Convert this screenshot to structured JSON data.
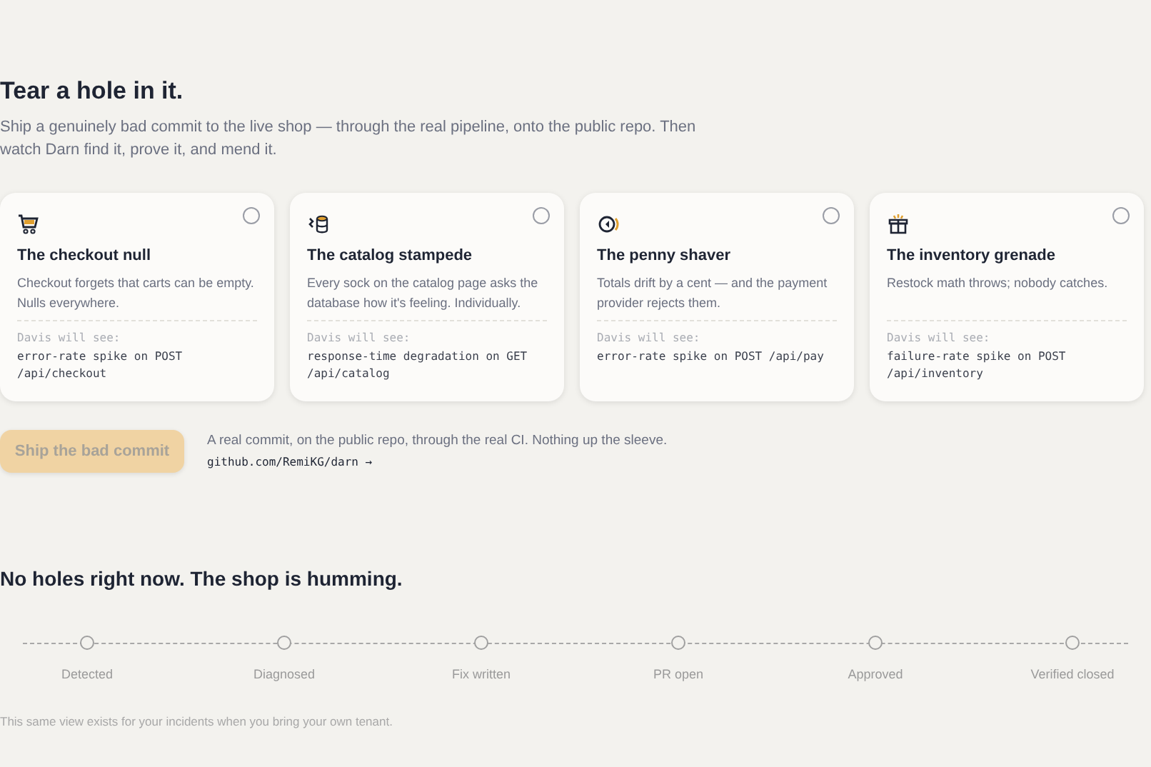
{
  "heading": "Tear a hole in it.",
  "intro": "Ship a genuinely bad commit to the live shop — through the real pipeline, onto the public repo. Then watch Darn find it, prove it, and mend it.",
  "scenarios": [
    {
      "kind": "cart",
      "title": "The checkout null",
      "description": "Checkout forgets that carts can be empty. Nulls everywhere.",
      "signal_label": "Davis will see:",
      "signal": "error-rate spike on POST /api/checkout",
      "selected": false
    },
    {
      "kind": "database",
      "title": "The catalog stampede",
      "description": "Every sock on the catalog page asks the database how it's feeling. Individually.",
      "signal_label": "Davis will see:",
      "signal": "response-time degradation on GET /api/catalog",
      "selected": false
    },
    {
      "kind": "coin",
      "title": "The penny shaver",
      "description": "Totals drift by a cent — and the payment provider rejects them.",
      "signal_label": "Davis will see:",
      "signal": "error-rate spike on POST /api/pay",
      "selected": false
    },
    {
      "kind": "box",
      "title": "The inventory grenade",
      "description": "Restock math throws; nobody catches.",
      "signal_label": "Davis will see:",
      "signal": "failure-rate spike on POST /api/inventory",
      "selected": false
    }
  ],
  "ship_button": {
    "label": "Ship the bad commit",
    "disabled": true
  },
  "ship_note": "A real commit, on the public repo, through the real CI. Nothing up the sleeve.",
  "repo_link": "github.com/RemiKG/darn →",
  "status_heading": "No holes right now. The shop is humming.",
  "stages": [
    {
      "label": "Detected"
    },
    {
      "label": "Diagnosed"
    },
    {
      "label": "Fix written"
    },
    {
      "label": "PR open"
    },
    {
      "label": "Approved"
    },
    {
      "label": "Verified closed"
    }
  ],
  "footnote": "This same view exists for your incidents when you bring your own tenant."
}
